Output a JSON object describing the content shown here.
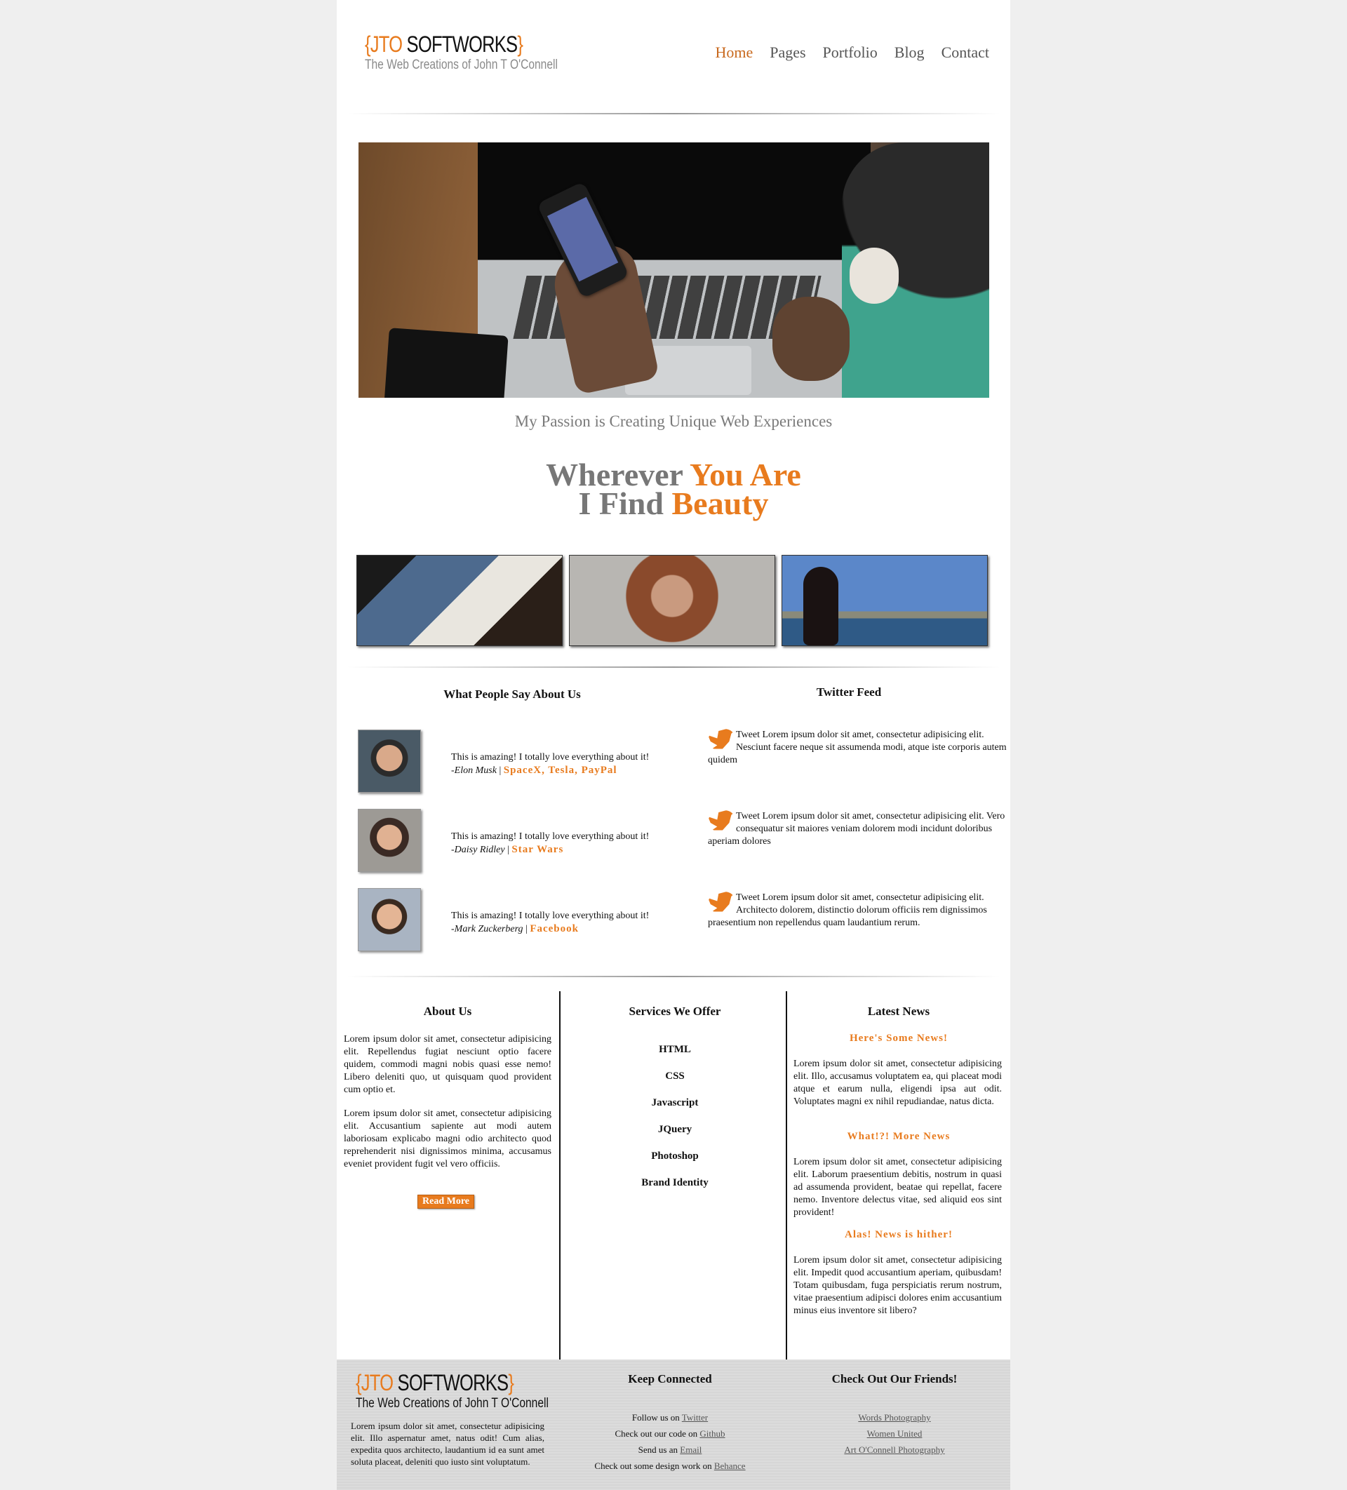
{
  "header": {
    "logo_brace_open": "{",
    "logo_jto": "JTO",
    "logo_softworks": " SOFTWORKS",
    "logo_brace_close": "}",
    "tagline": "The Web Creations of John T O'Connell",
    "nav": [
      {
        "label": "Home",
        "active": true
      },
      {
        "label": "Pages",
        "active": false
      },
      {
        "label": "Portfolio",
        "active": false
      },
      {
        "label": "Blog",
        "active": false
      },
      {
        "label": "Contact",
        "active": false
      }
    ]
  },
  "hero": {
    "subtitle": "My Passion is Creating Unique Web Experiences",
    "headline_line1_a": "Wherever ",
    "headline_line1_b": "You Are",
    "headline_line2_a": "I Find ",
    "headline_line2_b": "Beauty"
  },
  "testimonials": {
    "title": "What People Say About Us",
    "items": [
      {
        "quote": "This is amazing! I totally love everything about it!",
        "name": "-Elon Musk",
        "sep": " | ",
        "company": "SpaceX, Tesla, PayPal"
      },
      {
        "quote": "This is amazing! I totally love everything about it!",
        "name": "-Daisy Ridley",
        "sep": " | ",
        "company": "Star Wars"
      },
      {
        "quote": "This is amazing! I totally love everything about it!",
        "name": "-Mark Zuckerberg",
        "sep": " | ",
        "company": "Facebook"
      }
    ]
  },
  "twitter": {
    "title": "Twitter Feed",
    "tweets": [
      "Tweet Lorem ipsum dolor sit amet, consectetur adipisicing elit. Nesciunt facere neque sit assumenda modi, atque iste corporis autem quidem",
      "Tweet Lorem ipsum dolor sit amet, consectetur adipisicing elit. Vero consequatur sit maiores veniam dolorem modi incidunt doloribus aperiam dolores",
      "Tweet Lorem ipsum dolor sit amet, consectetur adipisicing elit. Architecto dolorem, distinctio dolorum officiis rem dignissimos praesentium non repellendus quam laudantium rerum."
    ]
  },
  "about": {
    "title": "About Us",
    "p1": "Lorem ipsum dolor sit amet, consectetur adipisicing elit. Repellendus fugiat nesciunt optio facere quidem, commodi magni nobis quasi esse nemo! Libero deleniti quo, ut quisquam quod provident cum optio et.",
    "p2": "Lorem ipsum dolor sit amet, consectetur adipisicing elit. Accusantium sapiente aut modi autem laboriosam explicabo magni odio architecto quod reprehenderit nisi dignissimos minima, accusamus eveniet provident fugit vel vero officiis.",
    "button": "Read More"
  },
  "services": {
    "title": "Services We Offer",
    "items": [
      "HTML",
      "CSS",
      "Javascript",
      "JQuery",
      "Photoshop",
      "Brand Identity"
    ]
  },
  "news": {
    "title": "Latest News",
    "items": [
      {
        "heading": "Here's Some News!",
        "text": "Lorem ipsum dolor sit amet, consectetur adipisicing elit. Illo, accusamus voluptatem ea, qui placeat modi atque et earum nulla, eligendi ipsa aut odit. Voluptates magni ex nihil repudiandae, natus dicta."
      },
      {
        "heading": "What!?! More News",
        "text": "Lorem ipsum dolor sit amet, consectetur adipisicing elit. Laborum praesentium debitis, nostrum in quasi ad assumenda provident, beatae qui repellat, facere nemo. Inventore delectus vitae, sed aliquid eos sint provident!"
      },
      {
        "heading": "Alas! News is hither!",
        "text": "Lorem ipsum dolor sit amet, consectetur adipisicing elit. Impedit quod accusantium aperiam, quibusdam! Totam quibusdam, fuga perspiciatis rerum nostrum, vitae praesentium adipisci dolores enim accusantium minus eius inventore sit libero?"
      }
    ]
  },
  "footer": {
    "about_text": "Lorem ipsum dolor sit amet, consectetur adipisicing elit. Illo aspernatur amet, natus odit! Cum alias, expedita quos architecto, laudantium id ea sunt amet soluta placeat, deleniti quo iusto sint voluptatum.",
    "connect_title": "Keep Connected",
    "connect": [
      {
        "prefix": "Follow us on ",
        "link": "Twitter"
      },
      {
        "prefix": "Check out our code on ",
        "link": "Github"
      },
      {
        "prefix": "Send us an ",
        "link": "Email"
      },
      {
        "prefix": "Check out some design work on ",
        "link": "Behance"
      }
    ],
    "friends_title": "Check Out Our Friends!",
    "friends": [
      "Words Photography",
      "Women United",
      "Art O'Connell Photography"
    ]
  },
  "colors": {
    "accent": "#e87b1e",
    "nav_active": "#c8691e",
    "headline_gray": "#777777",
    "page_bg": "#efefef",
    "footer_bg": "#d9d9d9"
  },
  "icons": {
    "tweet": "twitter-bird-icon"
  }
}
